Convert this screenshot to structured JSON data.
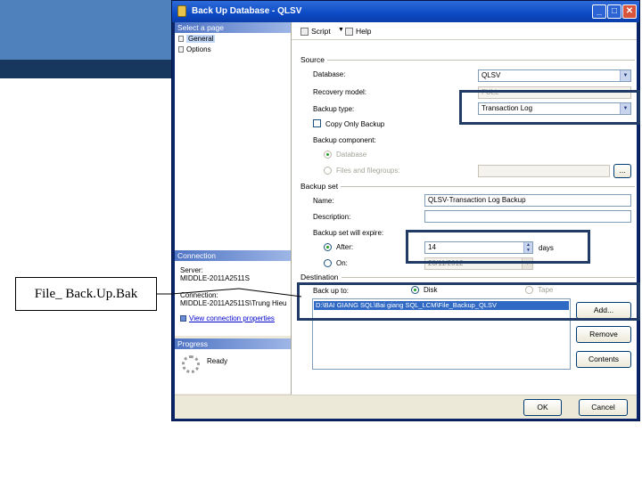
{
  "callout": {
    "text": "File_ Back.Up.Bak"
  },
  "window": {
    "title": "Back Up Database - QLSV",
    "min_glyph": "_",
    "max_glyph": "□",
    "close_glyph": "✕"
  },
  "left_pane": {
    "select_page_header": "Select a page",
    "pages": [
      "General",
      "Options"
    ],
    "connection_header": "Connection",
    "server_label": "Server:",
    "server_value": "MIDDLE-2011A2511S",
    "connection_label": "Connection:",
    "connection_value": "MIDDLE-2011A2511S\\Trung Hieu",
    "view_connection_link": "View connection properties",
    "progress_header": "Progress",
    "progress_status": "Ready"
  },
  "toolbar": {
    "script_label": "Script",
    "script_arrow": "▼",
    "help_label": "Help"
  },
  "source": {
    "group_label": "Source",
    "database_label": "Database:",
    "database_value": "QLSV",
    "recovery_label": "Recovery model:",
    "recovery_value": "FULL",
    "backup_type_label": "Backup type:",
    "backup_type_value": "Transaction Log",
    "copy_only_label": "Copy Only Backup",
    "component_label": "Backup component:",
    "component_database": "Database",
    "component_files": "Files and filegroups:",
    "browse_label": "..."
  },
  "backup_set": {
    "group_label": "Backup set",
    "name_label": "Name:",
    "name_value": "QLSV-Transaction Log  Backup",
    "description_label": "Description:",
    "description_value": "",
    "expire_label": "Backup set will expire:",
    "after_label": "After:",
    "after_value": "14",
    "days_label": "days",
    "on_label": "On:",
    "on_value": "20/11/2012"
  },
  "destination": {
    "group_label": "Destination",
    "backup_to_label": "Back up to:",
    "disk_label": "Disk",
    "tape_label": "Tape",
    "items": [
      "D:\\BAI GIANG SQL\\Bai giang SQL_LCM\\File_Backup_QLSV"
    ],
    "add_label": "Add...",
    "remove_label": "Remove",
    "contents_label": "Contents"
  },
  "footer": {
    "ok_label": "OK",
    "cancel_label": "Cancel"
  },
  "colors": {
    "slide_blue": "#4f81bd",
    "slide_navy": "#17375e",
    "title_bar": "#0c4ac6",
    "highlight_border": "#1f3b66",
    "selection": "#316ac5"
  }
}
